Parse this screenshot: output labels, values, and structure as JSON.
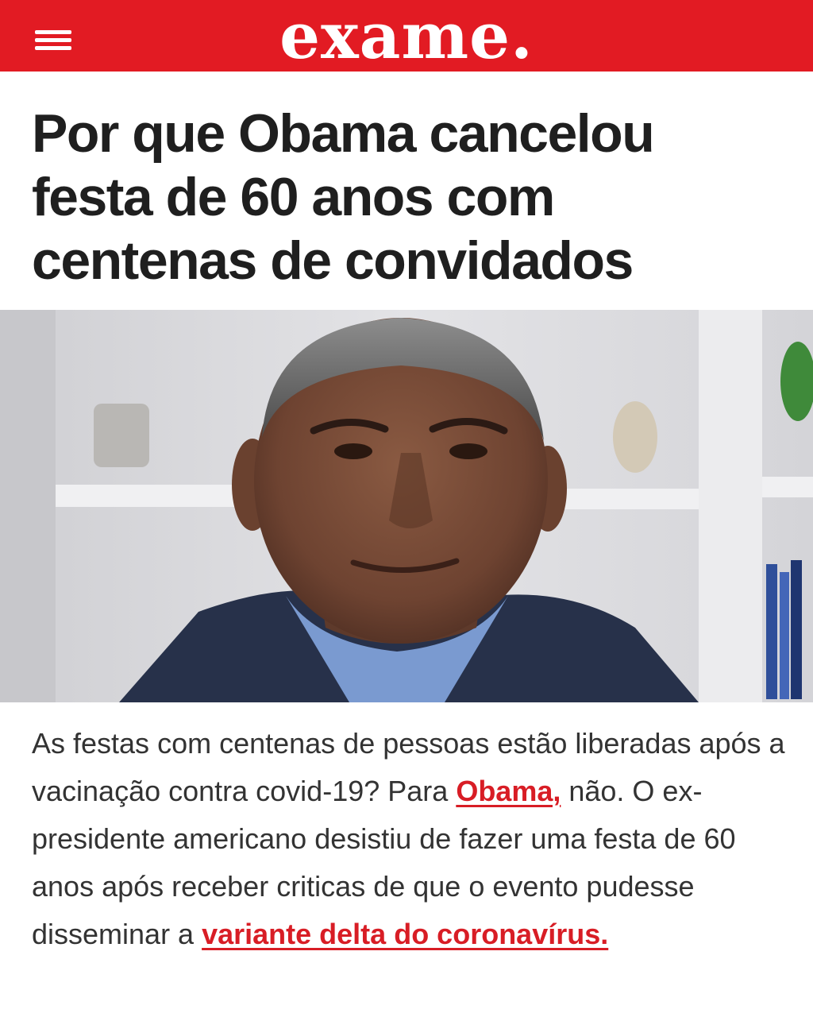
{
  "header": {
    "logo": "exame.",
    "menu_icon": "hamburger-menu-icon",
    "background_color": "#e21b23"
  },
  "article": {
    "headline": "Por que Obama cancelou festa de 60 anos com centenas de convidados",
    "image_alt": "Barack Obama",
    "paragraph": {
      "text_1": "As festas com centenas de pessoas estão liberadas após a vacinação contra covid-19? Para ",
      "link_1": "Obama,",
      "text_2": " não. O ex-presidente americano desistiu de fazer uma festa de 60 anos após receber criticas de que o evento pudesse disseminar a ",
      "link_2": "variante delta do coronavírus."
    },
    "link_color": "#d81d25"
  }
}
